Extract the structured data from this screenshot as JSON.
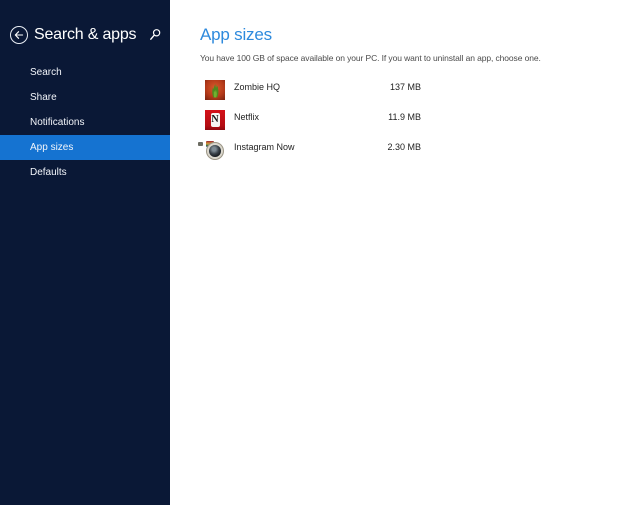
{
  "sidebar": {
    "title": "Search & apps",
    "items": [
      {
        "label": "Search",
        "selected": false
      },
      {
        "label": "Share",
        "selected": false
      },
      {
        "label": "Notifications",
        "selected": false
      },
      {
        "label": "App sizes",
        "selected": true
      },
      {
        "label": "Defaults",
        "selected": false
      }
    ]
  },
  "main": {
    "heading": "App sizes",
    "description": "You have 100 GB of space available on your PC. If you want to uninstall an app, choose one.",
    "apps": [
      {
        "name": "Zombie HQ",
        "size": "137 MB",
        "icon": "zombie-hand-icon"
      },
      {
        "name": "Netflix",
        "size": "11.9 MB",
        "icon": "netflix-icon"
      },
      {
        "name": "Instagram Now",
        "size": "2.30 MB",
        "icon": "instagram-camera-icon"
      }
    ]
  },
  "colors": {
    "sidebar_bg": "#0a1836",
    "selected_item_bg": "#1573d1",
    "heading_blue": "#2e8add"
  }
}
